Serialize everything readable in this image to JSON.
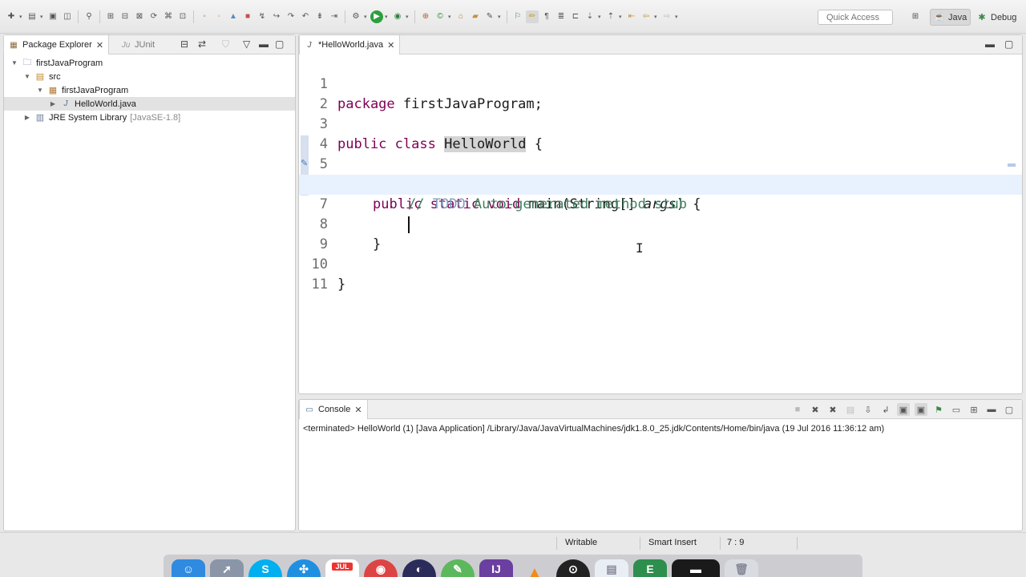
{
  "colors": {
    "keyword": "#7f0055",
    "comment": "#3f7f5f",
    "todo": "#7f9fbf",
    "current_line": "#e8f2fe",
    "selection": "#e2e2e2"
  },
  "toolbar": {
    "quick_access_placeholder": "Quick Access",
    "perspectives": [
      {
        "label": "Java",
        "icon": "java-perspective-icon",
        "active": true
      },
      {
        "label": "Debug",
        "icon": "debug-perspective-icon",
        "active": false
      }
    ]
  },
  "explorer": {
    "tabs": [
      {
        "label": "Package Explorer",
        "active": true
      },
      {
        "label": "JUnit",
        "active": false
      }
    ],
    "tree": [
      {
        "label": "firstJavaProgram",
        "extra": "",
        "level": 0,
        "expanded": true,
        "icon": "project-icon"
      },
      {
        "label": "src",
        "extra": "",
        "level": 1,
        "expanded": true,
        "icon": "source-folder-icon"
      },
      {
        "label": "firstJavaProgram",
        "extra": "",
        "level": 2,
        "expanded": true,
        "icon": "package-icon"
      },
      {
        "label": "HelloWorld.java",
        "extra": "",
        "level": 3,
        "expanded": false,
        "icon": "java-file-icon",
        "selected": true
      },
      {
        "label": "JRE System Library",
        "extra": "[JavaSE-1.8]",
        "level": 1,
        "expanded": false,
        "icon": "library-icon"
      }
    ]
  },
  "editor": {
    "tab_label": "*HelloWorld.java",
    "cursor_line": 7,
    "line_numbers": [
      "1",
      "2",
      "3",
      "4",
      "5",
      "6",
      "7",
      "8",
      "9",
      "10",
      "11"
    ],
    "lines": {
      "l1_kw": "package",
      "l1_rest": " firstJavaProgram;",
      "l3_kw1": "public",
      "l3_kw2": "class",
      "l3_name": "HelloWorld",
      "l3_rest": " {",
      "l5_kw1": "public",
      "l5_kw2": "static",
      "l5_kw3": "void",
      "l5_mid": " main(String[] ",
      "l5_arg": "args",
      "l5_rest": ") {",
      "l6_slashes": "// ",
      "l6_todo": "TODO",
      "l6_rest": " Auto-generated method stub",
      "l8": "}",
      "l10": "}"
    }
  },
  "console": {
    "tab_label": "Console",
    "header": "<terminated> HelloWorld (1) [Java Application] /Library/Java/JavaVirtualMachines/jdk1.8.0_25.jdk/Contents/Home/bin/java (19 Jul 2016 11:36:12 am)"
  },
  "status": {
    "writable": "Writable",
    "insert_mode": "Smart Insert",
    "position": "7 : 9"
  },
  "dock": {
    "apps": [
      "finder-icon",
      "launchpad-icon",
      "skype-icon",
      "safari-icon",
      "calendar-icon",
      "chrome-icon",
      "eclipse-icon",
      "evernote-icon",
      "intellij-icon",
      "vlc-icon",
      "github-icon",
      "preview-icon",
      "terminal-icon",
      "trash-icon"
    ],
    "calendar_month": "JUL"
  }
}
